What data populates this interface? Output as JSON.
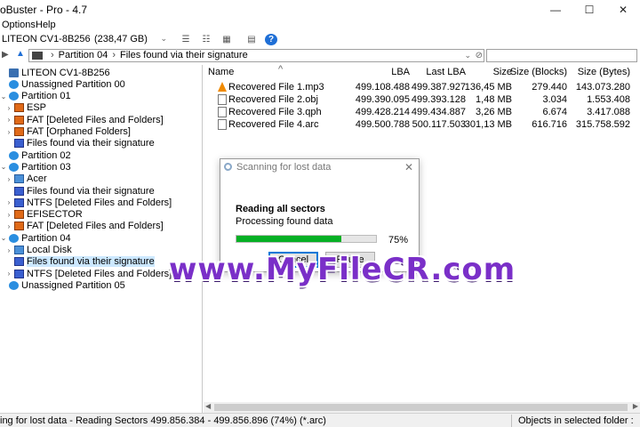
{
  "window": {
    "title": "oBuster - Pro - 4.7",
    "minimize": "—",
    "maximize": "☐",
    "close": "✕"
  },
  "menu": [
    "Options",
    "Help"
  ],
  "toolbar": {
    "drive_name": "LITEON   CV1-8B256",
    "drive_size": "(238,47 GB)"
  },
  "address": {
    "partition": "Partition 04",
    "folder": "Files found via their signature"
  },
  "tree": [
    {
      "label": "LITEON CV1-8B256",
      "icon": "disk-icon",
      "expander": "",
      "indent": 0,
      "selected": false
    },
    {
      "label": "Unassigned Partition 00",
      "icon": "partition-icon",
      "expander": "",
      "indent": 0,
      "selected": false
    },
    {
      "label": "Partition 01",
      "icon": "partition-icon",
      "expander": "⌄",
      "indent": 0,
      "selected": false
    },
    {
      "label": "ESP",
      "icon": "filesystem-icon",
      "expander": "›",
      "indent": 1,
      "selected": false
    },
    {
      "label": "FAT [Deleted Files and Folders]",
      "icon": "filesystem-icon",
      "expander": "›",
      "indent": 1,
      "selected": false
    },
    {
      "label": "FAT [Orphaned Folders]",
      "icon": "filesystem-icon",
      "expander": "›",
      "indent": 1,
      "selected": false
    },
    {
      "label": "Files found via their signature",
      "icon": "signature-icon",
      "expander": "",
      "indent": 1,
      "selected": false
    },
    {
      "label": "Partition 02",
      "icon": "partition-icon",
      "expander": "",
      "indent": 0,
      "selected": false
    },
    {
      "label": "Partition 03",
      "icon": "partition-icon",
      "expander": "⌄",
      "indent": 0,
      "selected": false
    },
    {
      "label": "Acer",
      "icon": "local-disk-icon",
      "expander": "›",
      "indent": 1,
      "selected": false
    },
    {
      "label": "Files found via their signature",
      "icon": "signature-icon",
      "expander": "",
      "indent": 1,
      "selected": false
    },
    {
      "label": "NTFS [Deleted Files and Folders]",
      "icon": "signature-icon",
      "expander": "›",
      "indent": 1,
      "selected": false
    },
    {
      "label": "EFISECTOR",
      "icon": "filesystem-icon",
      "expander": "›",
      "indent": 1,
      "selected": false
    },
    {
      "label": "FAT [Deleted Files and Folders]",
      "icon": "filesystem-icon",
      "expander": "›",
      "indent": 1,
      "selected": false
    },
    {
      "label": "Partition 04",
      "icon": "partition-icon",
      "expander": "⌄",
      "indent": 0,
      "selected": false
    },
    {
      "label": "Local Disk",
      "icon": "local-disk-icon",
      "expander": "›",
      "indent": 1,
      "selected": false
    },
    {
      "label": "Files found via their signature",
      "icon": "signature-icon",
      "expander": "",
      "indent": 1,
      "selected": true
    },
    {
      "label": "NTFS [Deleted Files and Folders]",
      "icon": "signature-icon",
      "expander": "›",
      "indent": 1,
      "selected": false
    },
    {
      "label": "Unassigned Partition 05",
      "icon": "partition-icon",
      "expander": "",
      "indent": 0,
      "selected": false
    }
  ],
  "columns": [
    "Name",
    "LBA",
    "Last LBA",
    "Size",
    "Size (Blocks)",
    "Size (Bytes)"
  ],
  "files": [
    {
      "name": "Recovered File 1.mp3",
      "icon": "vlc-icon",
      "lba": "499.108.488",
      "last_lba": "499.387.927",
      "size": "136,45 MB",
      "blocks": "279.440",
      "bytes": "143.073.280"
    },
    {
      "name": "Recovered File 2.obj",
      "icon": "object-file-icon",
      "lba": "499.390.095",
      "last_lba": "499.393.128",
      "size": "1,48 MB",
      "blocks": "3.034",
      "bytes": "1.553.408"
    },
    {
      "name": "Recovered File 3.qph",
      "icon": "file-icon",
      "lba": "499.428.214",
      "last_lba": "499.434.887",
      "size": "3,26 MB",
      "blocks": "6.674",
      "bytes": "3.417.088"
    },
    {
      "name": "Recovered File 4.arc",
      "icon": "file-icon",
      "lba": "499.500.788",
      "last_lba": "500.117.503",
      "size": "301,13 MB",
      "blocks": "616.716",
      "bytes": "315.758.592"
    }
  ],
  "dialog": {
    "title": "Scanning for lost data",
    "heading": "Reading all sectors",
    "subtext": "Processing found data",
    "progress": 0.75,
    "progress_label": "75%",
    "cancel": "Cancel",
    "pause": "Pause"
  },
  "status": {
    "left": "ing for lost data - Reading Sectors 499.856.384 - 499.856.896  (74%) (*.arc)",
    "right": "Objects in selected folder : 4"
  },
  "watermark": "www.MyFileCR.com",
  "colors": {
    "progress": "#06b025",
    "selection": "#cce8ff",
    "watermark": "#7a2fc8"
  }
}
